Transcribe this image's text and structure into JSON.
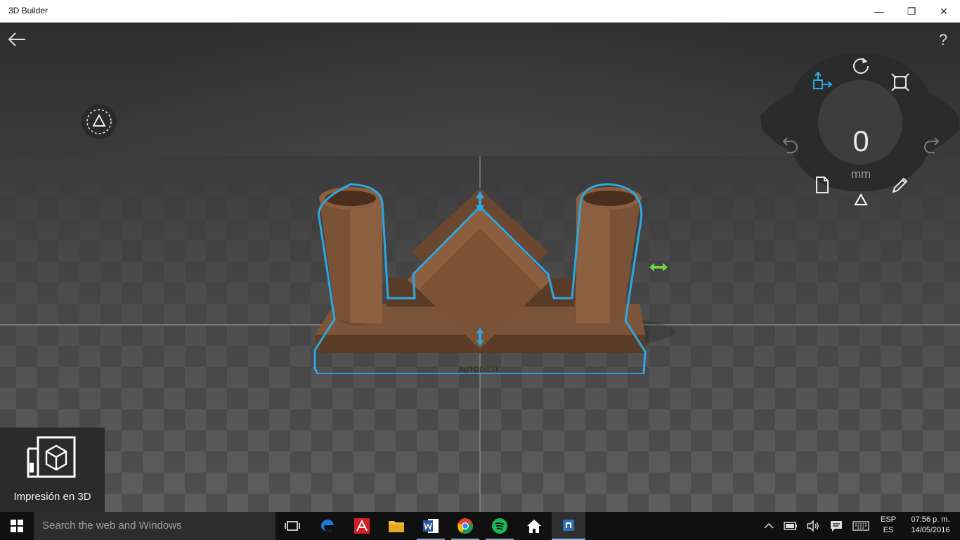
{
  "window": {
    "title": "3D Builder",
    "minimize_glyph": "—",
    "maximize_glyph": "❐",
    "close_glyph": "✕"
  },
  "toolbar": {
    "help_label": "?"
  },
  "wheel": {
    "value": "0",
    "unit": "mm"
  },
  "model": {
    "brand_text": "AUTODESK"
  },
  "print_tile": {
    "label": "Impresión en 3D"
  },
  "taskbar": {
    "search_placeholder": "Search the web and Windows",
    "language_top": "ESP",
    "language_bottom": "ES",
    "time": "07:56 p. m.",
    "date": "14/05/2016"
  },
  "colors": {
    "accent": "#2ea7e0",
    "model_brown": "#7a5236",
    "wheel_bg": "#2b2b2b",
    "taskbar_bg": "#101010"
  }
}
